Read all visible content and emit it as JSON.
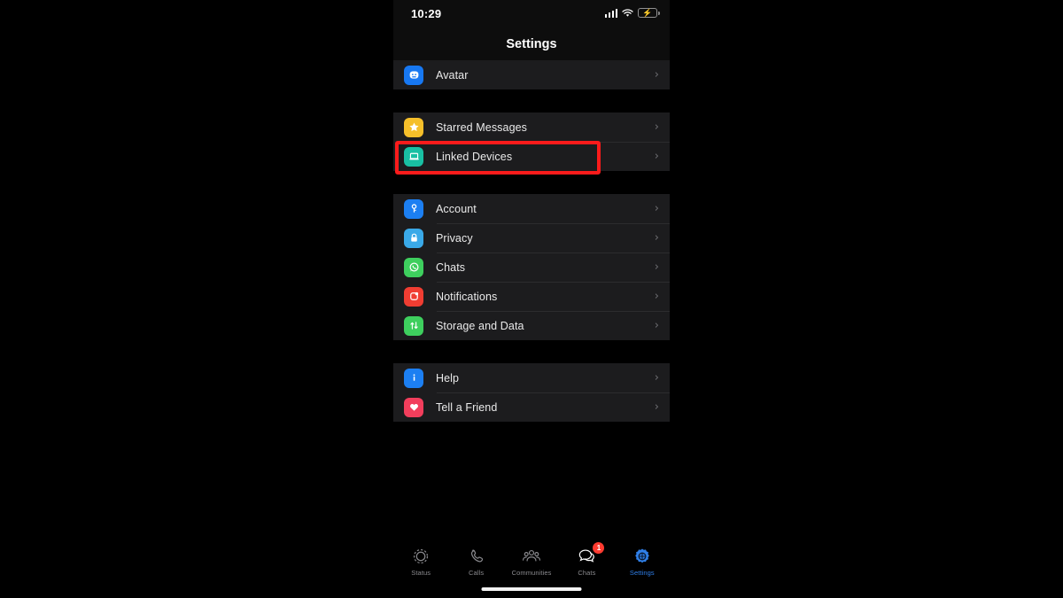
{
  "status_bar": {
    "time": "10:29",
    "signal_icon": "cellular-signal-icon",
    "wifi_icon": "wifi-icon",
    "battery_icon": "battery-charging-icon"
  },
  "nav": {
    "title": "Settings"
  },
  "groups": [
    {
      "name": "profile-group",
      "rows": [
        {
          "label": "Avatar",
          "icon": "avatar-icon",
          "color": "#1778f2",
          "chevron": "›"
        }
      ]
    },
    {
      "name": "shortcuts-group",
      "rows": [
        {
          "label": "Starred Messages",
          "icon": "star-icon",
          "color": "#f5bf2a",
          "chevron": "›"
        },
        {
          "label": "Linked Devices",
          "icon": "laptop-icon",
          "color": "#19c0a3",
          "chevron": "›"
        }
      ]
    },
    {
      "name": "preferences-group",
      "rows": [
        {
          "label": "Account",
          "icon": "key-icon",
          "color": "#1c7ff2",
          "chevron": "›"
        },
        {
          "label": "Privacy",
          "icon": "lock-icon",
          "color": "#3aa9e8",
          "chevron": "›"
        },
        {
          "label": "Chats",
          "icon": "chat-bubble-icon",
          "color": "#3ecf5e",
          "chevron": "›"
        },
        {
          "label": "Notifications",
          "icon": "bell-icon",
          "color": "#f03d32",
          "chevron": "›"
        },
        {
          "label": "Storage and Data",
          "icon": "arrows-up-down-icon",
          "color": "#3ecf5e",
          "chevron": "›"
        }
      ]
    },
    {
      "name": "support-group",
      "rows": [
        {
          "label": "Help",
          "icon": "info-icon",
          "color": "#1c7ff2",
          "chevron": "›"
        },
        {
          "label": "Tell a Friend",
          "icon": "heart-icon",
          "color": "#f23e5c",
          "chevron": "›"
        }
      ]
    }
  ],
  "highlight": {
    "target_label": "Linked Devices",
    "color": "#fb1b1b"
  },
  "tab_bar": {
    "tabs": [
      {
        "label": "Status",
        "icon": "status-ring-icon",
        "active": false,
        "badge": null
      },
      {
        "label": "Calls",
        "icon": "phone-icon",
        "active": false,
        "badge": null
      },
      {
        "label": "Communities",
        "icon": "communities-icon",
        "active": false,
        "badge": null
      },
      {
        "label": "Chats",
        "icon": "chats-icon",
        "active": false,
        "badge": "1"
      },
      {
        "label": "Settings",
        "icon": "gear-icon",
        "active": true,
        "badge": null
      }
    ],
    "active_color": "#2f7fe8",
    "inactive_color": "#8a8a8e",
    "badge_color": "#ff3b30"
  }
}
